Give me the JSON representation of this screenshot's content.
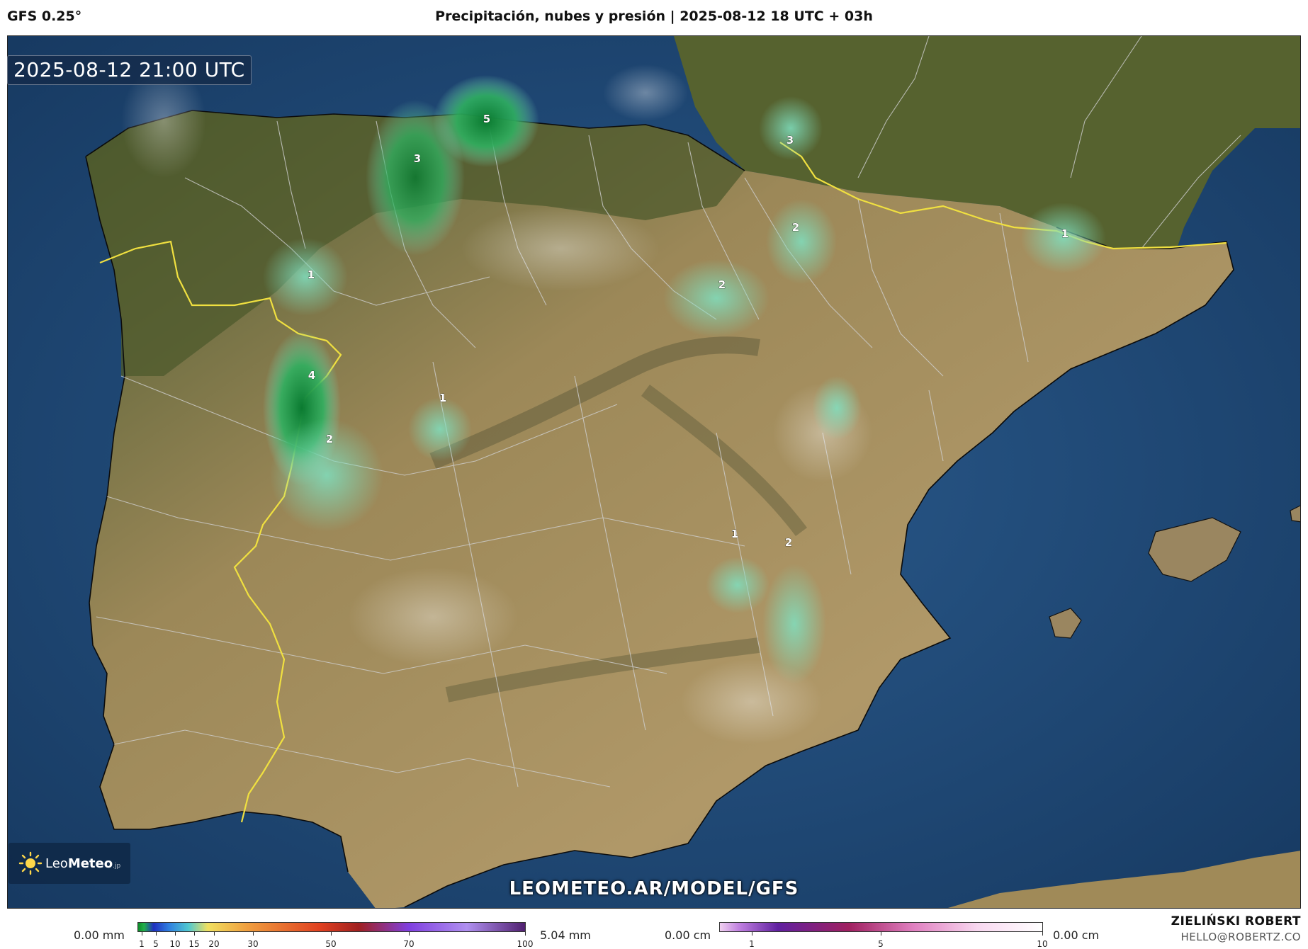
{
  "header": {
    "model": "GFS 0.25°",
    "title": "Precipitación, nubes y presión | 2025-08-12 18 UTC + 03h"
  },
  "map": {
    "valid_time": "2025-08-12 21:00 UTC",
    "source_url": "LEOMETEO.AR/MODEL/GFS",
    "logo": {
      "prefix": "Leo",
      "suffix": "Meteo",
      "tld": ".jp"
    },
    "rain_labels": [
      "5",
      "3",
      "3",
      "2",
      "2",
      "1",
      "1",
      "4",
      "1",
      "2",
      "1",
      "2"
    ]
  },
  "legend_precip": {
    "min_label": "0.00 mm",
    "max_label": "5.04 mm",
    "ticks": [
      "1",
      "5",
      "10",
      "15",
      "20",
      "30",
      "50",
      "70",
      "100"
    ]
  },
  "legend_snow": {
    "min_label": "0.00 cm",
    "max_label": "0.00 cm",
    "ticks": [
      "1",
      "5",
      "10"
    ]
  },
  "credits": {
    "author": "ZIELIŃSKI ROBERT",
    "email": "HELLO@ROBERTZ.CO"
  },
  "colors": {
    "sea": "#1f4a78",
    "land": "#a08a58",
    "rain_light": "#7fe0c0",
    "rain_heavy": "#0a7a30",
    "border": "#f0e040"
  }
}
